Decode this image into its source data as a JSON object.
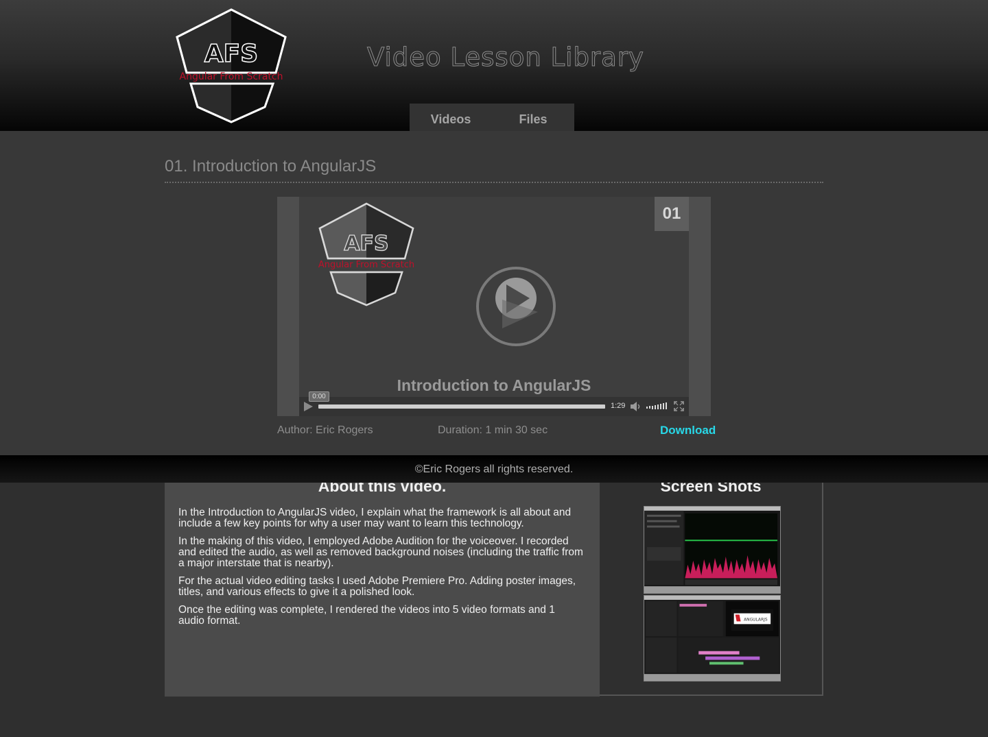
{
  "header": {
    "logo_text": "AFS",
    "logo_subtitle": "Angular From Scratch",
    "site_title": "Video Lesson Library",
    "nav": [
      {
        "label": "Videos"
      },
      {
        "label": "Files"
      }
    ]
  },
  "lesson": {
    "title": "01. Introduction to AngularJS",
    "number_badge": "01",
    "video_caption": "Introduction to AngularJS",
    "player": {
      "current_time": "0:00",
      "total_time": "1:29",
      "progress": 0
    },
    "author": "Author: Eric Rogers",
    "duration": "Duration: 1 min 30 sec",
    "download_label": "Download"
  },
  "footer": {
    "copyright": "©Eric Rogers all rights reserved."
  },
  "about": {
    "heading": "About this video.",
    "paragraphs": [
      "In the Introduction to AngularJS video, I explain what the framework is all about and include a few key points for why a user may want to learn this technology.",
      "In the making of this video, I employed Adobe Audition for the voiceover. I recorded and edited the audio, as well as removed background noises (including the traffic from a major interstate that is nearby).",
      "For the actual video editing tasks I used Adobe Premiere Pro. Adding poster images, titles, and various effects to give it a polished look.",
      "Once the editing was complete, I rendered the videos into 5 video formats and 1 audio format."
    ]
  },
  "screenshots": {
    "heading": "Screen Shots",
    "shot2_title": "ANGULARJS"
  },
  "colors": {
    "accent_link": "#28d8e8",
    "logo_red": "#c0102a",
    "header_bg": "#2a2a2a",
    "main_bg": "#383838",
    "panel_bg": "#4b4b4b"
  }
}
